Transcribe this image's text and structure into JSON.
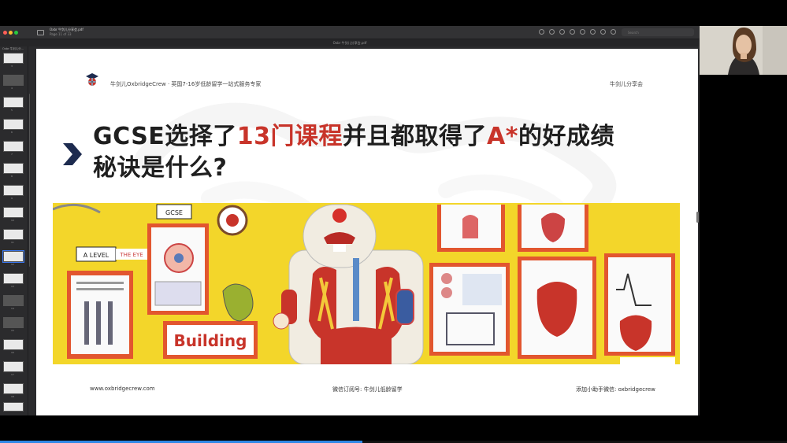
{
  "app": {
    "doc_title": "Oxbr 牛剑儿分享会.pdf",
    "doc_page": "Page 11 of 33",
    "tab_title": "Oxbr 牛剑儿分享会.pdf",
    "search_placeholder": "Search",
    "thumbs_title": "Oxbr 牛剑儿分...",
    "thumbnail_numbers": [
      "3",
      "4",
      "5",
      "6",
      "7",
      "8",
      "9",
      "10",
      "11",
      "12",
      "13",
      "14",
      "15",
      "16",
      "17",
      "18",
      "19"
    ]
  },
  "slide": {
    "brand_line": "牛剑儿OxbridgeCrew · 英国7-16岁低龄留学一站式服务专家",
    "top_right": "牛剑儿分享会",
    "heading_part1": "GCSE选择了",
    "heading_red1": "13门课程",
    "heading_part2": "并且都取得了",
    "heading_red2": "A*",
    "heading_part3": "的好成绩",
    "heading_line2": "秘诀是什么?",
    "photo_labels": {
      "gcse": "GCSE",
      "a_level": "A LEVEL",
      "the_eye": "THE EYE",
      "building": "Building"
    },
    "footer_left": "www.oxbridgecrew.com",
    "footer_mid": "微信订阅号: 牛剑儿低龄留学",
    "footer_right": "添加小助手微信: oxbridgecrew"
  },
  "colors": {
    "accent_red": "#c8342a",
    "heading_dark": "#1f1f1f",
    "chevron_navy": "#1d2b4f",
    "photo_yellow": "#f3d62a",
    "progress_blue": "#2f87e6"
  }
}
